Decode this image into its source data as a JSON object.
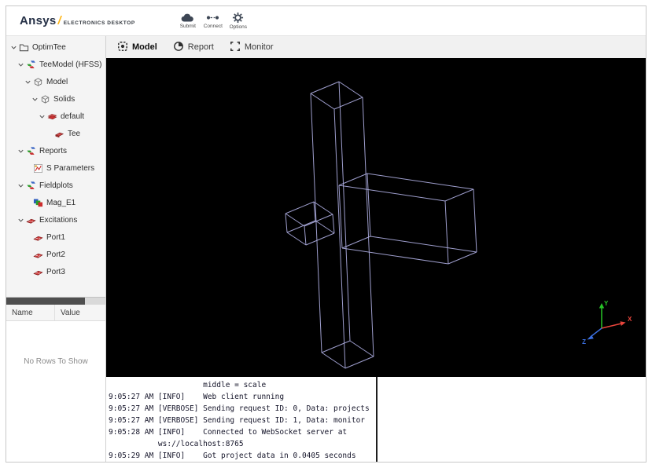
{
  "header": {
    "logo": {
      "brand": "Ansys",
      "slash": "/",
      "product": "ELECTRONICS DESKTOP"
    },
    "toolbar": {
      "submit": "Submit",
      "connect": "Connect",
      "options": "Options"
    }
  },
  "tabs": {
    "model": "Model",
    "report": "Report",
    "monitor": "Monitor"
  },
  "sidebar": {
    "tree": [
      {
        "label": "OptimTee",
        "level": 0,
        "expandable": true,
        "icon": "folder-icon"
      },
      {
        "label": "TeeModel (HFSS)",
        "level": 1,
        "expandable": true,
        "icon": "design-icon"
      },
      {
        "label": "Model",
        "level": 2,
        "expandable": true,
        "icon": "geometry-icon"
      },
      {
        "label": "Solids",
        "level": 3,
        "expandable": true,
        "icon": "solids-icon"
      },
      {
        "label": "default",
        "level": 4,
        "expandable": true,
        "icon": "material-icon"
      },
      {
        "label": "Tee",
        "level": 5,
        "expandable": false,
        "icon": "solid-icon"
      },
      {
        "label": "Reports",
        "level": 1,
        "expandable": true,
        "icon": "reports-icon"
      },
      {
        "label": "S Parameters",
        "level": 2,
        "expandable": false,
        "icon": "sparameters-icon"
      },
      {
        "label": "Fieldplots",
        "level": 1,
        "expandable": true,
        "icon": "fieldplots-icon"
      },
      {
        "label": "Mag_E1",
        "level": 2,
        "expandable": false,
        "icon": "fieldplot-icon"
      },
      {
        "label": "Excitations",
        "level": 1,
        "expandable": true,
        "icon": "excitations-icon"
      },
      {
        "label": "Port1",
        "level": 2,
        "expandable": false,
        "icon": "port-icon"
      },
      {
        "label": "Port2",
        "level": 2,
        "expandable": false,
        "icon": "port-icon"
      },
      {
        "label": "Port3",
        "level": 2,
        "expandable": false,
        "icon": "port-icon"
      }
    ],
    "properties": {
      "name_column": "Name",
      "value_column": "Value",
      "empty_text": "No Rows To Show"
    }
  },
  "viewport": {
    "axis_x": "X",
    "axis_y": "Y",
    "axis_z": "Z"
  },
  "colors": {
    "brand_gold": "#ffb71b",
    "wireframe": "#a7a7d8",
    "axis_x": "#e8453c",
    "axis_y": "#27c427",
    "axis_z": "#3b6fe0"
  },
  "console": {
    "lines": [
      "                     middle = scale",
      "9:05:27 AM [INFO]    Web client running",
      "9:05:27 AM [VERBOSE] Sending request ID: 0, Data: projects",
      "9:05:27 AM [VERBOSE] Sending request ID: 1, Data: monitor",
      "9:05:28 AM [INFO]    Connected to WebSocket server at",
      "           ws://localhost:8765",
      "9:05:29 AM [INFO]    Got project data in 0.0405 seconds"
    ]
  }
}
